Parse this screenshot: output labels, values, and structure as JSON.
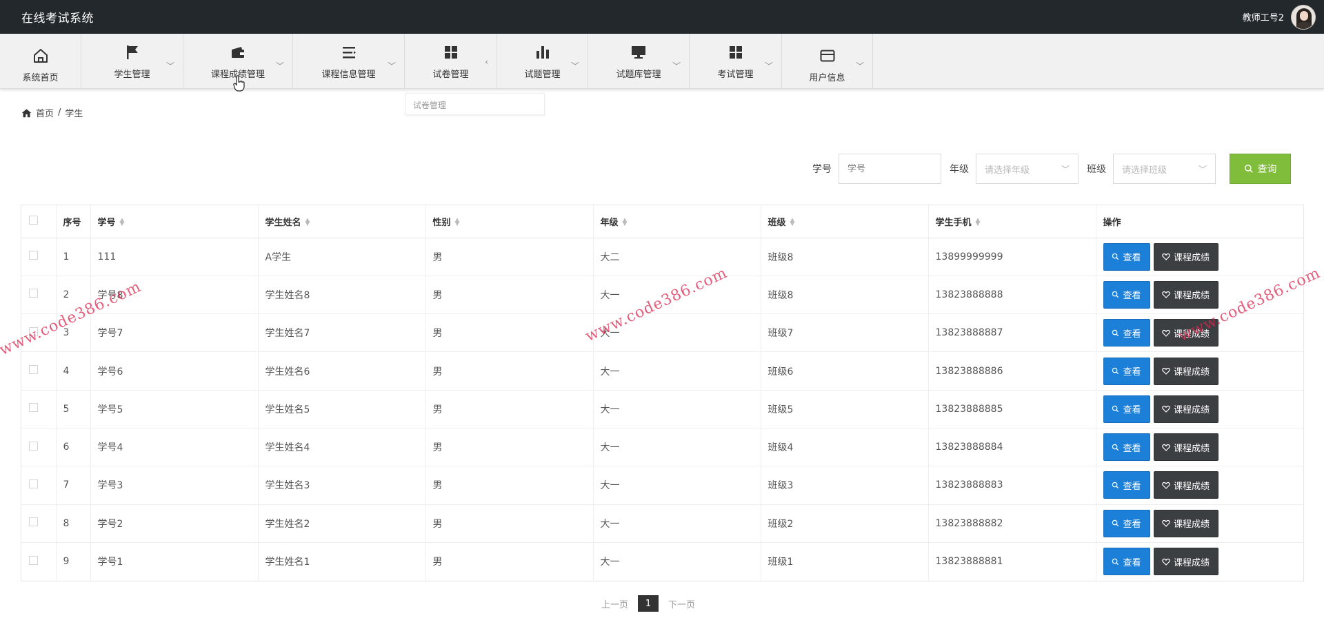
{
  "app": {
    "title": "在线考试系统",
    "user_name": "教师工号2"
  },
  "nav": [
    {
      "label": "系统首页",
      "icon": "home-icon"
    },
    {
      "label": "学生管理",
      "icon": "flag-icon"
    },
    {
      "label": "课程成绩管理",
      "icon": "wallet-icon"
    },
    {
      "label": "课程信息管理",
      "icon": "list-icon"
    },
    {
      "label": "试卷管理",
      "icon": "grid-icon"
    },
    {
      "label": "试题管理",
      "icon": "bar-chart-icon"
    },
    {
      "label": "试题库管理",
      "icon": "monitor-icon"
    },
    {
      "label": "考试管理",
      "icon": "grid-icon"
    },
    {
      "label": "用户信息",
      "icon": "card-icon"
    }
  ],
  "dropdown_tip": "试卷管理",
  "breadcrumb": {
    "home": "首页",
    "sep": "/",
    "current": "学生"
  },
  "search": {
    "student_no_label": "学号",
    "student_no_placeholder": "学号",
    "grade_label": "年级",
    "grade_placeholder": "请选择年级",
    "class_label": "班级",
    "class_placeholder": "请选择班级",
    "query_button": "查询"
  },
  "table": {
    "headers": [
      "序号",
      "学号",
      "学生姓名",
      "性别",
      "年级",
      "班级",
      "学生手机",
      "操作"
    ],
    "view_label": "查看",
    "score_label": "课程成绩",
    "rows": [
      [
        "1",
        "111",
        "A学生",
        "男",
        "大二",
        "班级8",
        "13899999999"
      ],
      [
        "2",
        "学号8",
        "学生姓名8",
        "男",
        "大一",
        "班级8",
        "13823888888"
      ],
      [
        "3",
        "学号7",
        "学生姓名7",
        "男",
        "大一",
        "班级7",
        "13823888887"
      ],
      [
        "4",
        "学号6",
        "学生姓名6",
        "男",
        "大一",
        "班级6",
        "13823888886"
      ],
      [
        "5",
        "学号5",
        "学生姓名5",
        "男",
        "大一",
        "班级5",
        "13823888885"
      ],
      [
        "6",
        "学号4",
        "学生姓名4",
        "男",
        "大一",
        "班级4",
        "13823888884"
      ],
      [
        "7",
        "学号3",
        "学生姓名3",
        "男",
        "大一",
        "班级3",
        "13823888883"
      ],
      [
        "8",
        "学号2",
        "学生姓名2",
        "男",
        "大一",
        "班级2",
        "13823888882"
      ],
      [
        "9",
        "学号1",
        "学生姓名1",
        "男",
        "大一",
        "班级1",
        "13823888881"
      ]
    ]
  },
  "pagination": {
    "prev": "上一页",
    "current": "1",
    "next": "下一页"
  },
  "watermark": "www.code386.com",
  "colors": {
    "topbar": "#23282d",
    "query": "#7fbd3a",
    "view": "#1c7fd8",
    "score": "#3c3f42"
  }
}
